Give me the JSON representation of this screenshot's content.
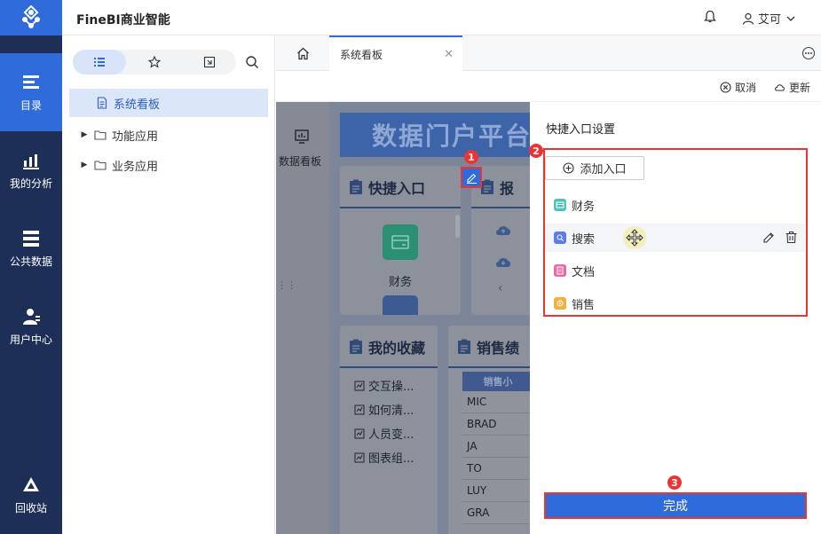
{
  "app": {
    "title": "FineBI商业智能",
    "user_name": "艾可"
  },
  "nav": {
    "items": [
      {
        "label": "目录",
        "icon": "catalog-icon",
        "active": true
      },
      {
        "label": "我的分析",
        "icon": "analysis-icon"
      },
      {
        "label": "公共数据",
        "icon": "database-icon"
      },
      {
        "label": "用户中心",
        "icon": "user-center-icon"
      },
      {
        "label": "回收站",
        "icon": "recycle-icon"
      }
    ]
  },
  "tree": {
    "tabs": [
      "list-icon",
      "star-icon",
      "export-icon"
    ],
    "items": [
      {
        "label": "系统看板",
        "selected": true
      },
      {
        "label": "功能应用"
      },
      {
        "label": "业务应用"
      }
    ]
  },
  "tabbar": {
    "tab_label": "系统看板"
  },
  "toolbar": {
    "cancel_label": "取消",
    "update_label": "更新"
  },
  "dashboard": {
    "side_label": "数据看板",
    "banner": "数据门户平台",
    "quick_card_title": "快捷入口",
    "report_card_title": "报",
    "finance_label": "财务",
    "fav_card_title": "我的收藏",
    "fav_items": [
      "交互操...",
      "如何清...",
      "人员变...",
      "图表组..."
    ],
    "sales_card_title": "销售绩",
    "sales_header": "销售小",
    "sales_rows": [
      "MIC",
      "BRAD",
      "JA",
      "TO",
      "LUY",
      "GRA"
    ]
  },
  "annotations": {
    "badge1": "1",
    "badge2": "2",
    "badge3": "3"
  },
  "panel": {
    "title": "快捷入口设置",
    "add_label": "添加入口",
    "entries": [
      {
        "label": "财务",
        "color": "#4fc3b5"
      },
      {
        "label": "搜索",
        "color": "#5b7de8"
      },
      {
        "label": "文档",
        "color": "#e86aa8"
      },
      {
        "label": "销售",
        "color": "#f0b13d"
      }
    ],
    "done_label": "完成"
  },
  "colors": {
    "brand": "#2f6bdb",
    "nav_bg": "#1d2e57",
    "alert": "#e33333"
  }
}
